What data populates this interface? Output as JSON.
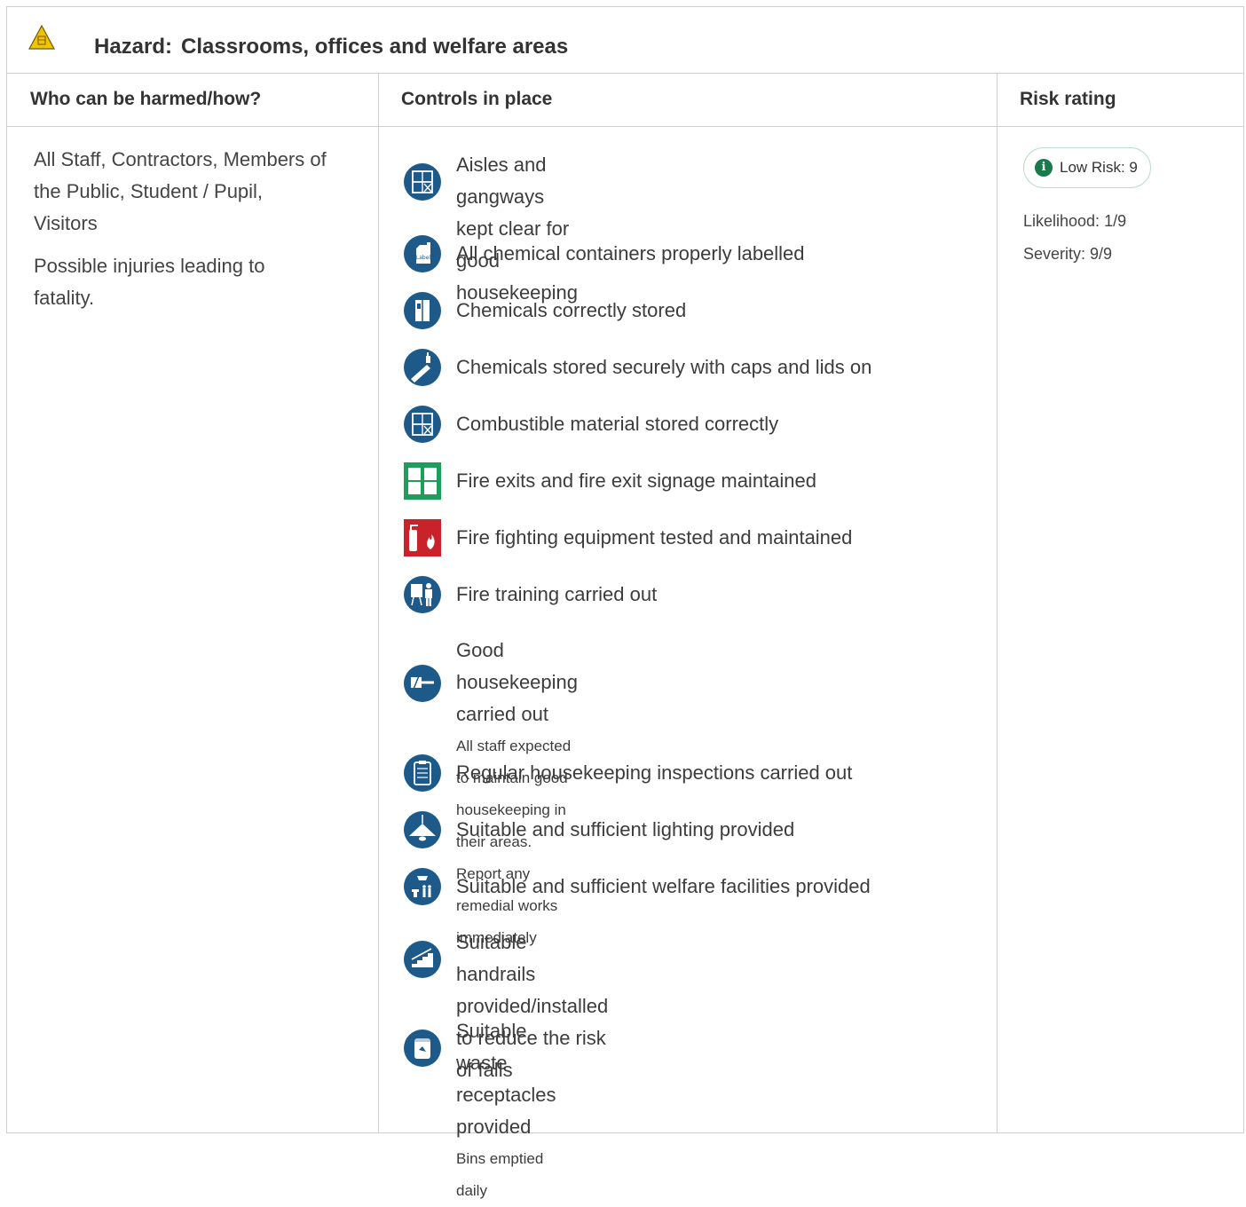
{
  "hazard": {
    "prefix": "Hazard:",
    "title": "Classrooms, offices and welfare areas",
    "icon": "warning-triangle-icon"
  },
  "columns": {
    "who": "Who can be harmed/how?",
    "controls": "Controls in place",
    "risk": "Risk rating"
  },
  "who": {
    "people": "All Staff, Contractors, Members of the Public, Student / Pupil, Visitors",
    "injuries": "Possible injuries leading to fatality."
  },
  "controls": [
    {
      "text": "Aisles and gangways kept clear for good housekeeping",
      "icon": "storage-shelf-icon"
    },
    {
      "text": "All chemical containers properly labelled",
      "icon": "labelled-container-icon"
    },
    {
      "text": "Chemicals correctly stored",
      "icon": "chemical-cabinet-icon"
    },
    {
      "text": "Chemicals stored securely with caps and lids on",
      "icon": "chemical-bottle-icon"
    },
    {
      "text": "Combustible material stored correctly",
      "icon": "storage-shelf-icon"
    },
    {
      "text": "Fire exits and fire exit signage maintained",
      "icon": "fire-exit-sign-icon"
    },
    {
      "text": "Fire fighting equipment tested and maintained",
      "icon": "fire-extinguisher-sign-icon"
    },
    {
      "text": "Fire training carried out",
      "icon": "training-presentation-icon"
    },
    {
      "text": "Good housekeeping carried out",
      "sub": "All staff expected to maintain good housekeeping in their areas. Report any remedial works immediately",
      "icon": "cleaning-icon"
    },
    {
      "text": "Regular housekeeping inspections carried out",
      "icon": "clipboard-checklist-icon"
    },
    {
      "text": "Suitable and sufficient lighting provided",
      "icon": "ceiling-lamp-icon"
    },
    {
      "text": "Suitable and sufficient welfare facilities provided",
      "icon": "welfare-facilities-icon"
    },
    {
      "text": "Suitable handrails provided/installed to reduce the risk of falls",
      "icon": "stairs-handrail-icon"
    },
    {
      "text": "Suitable waste receptacles provided",
      "sub": "Bins emptied daily",
      "icon": "waste-bin-icon"
    }
  ],
  "risk": {
    "badge": "Low Risk: 9",
    "likelihood": "Likelihood: 1/9",
    "severity": "Severity: 9/9",
    "colors": {
      "badge_border": "#b9dccc",
      "info": "#1b7a4c"
    }
  },
  "colors": {
    "icon_blue": "#1d5a8a",
    "exit_green": "#1e9e5a",
    "fire_red": "#c8222b",
    "warning_yellow": "#f2c300"
  }
}
